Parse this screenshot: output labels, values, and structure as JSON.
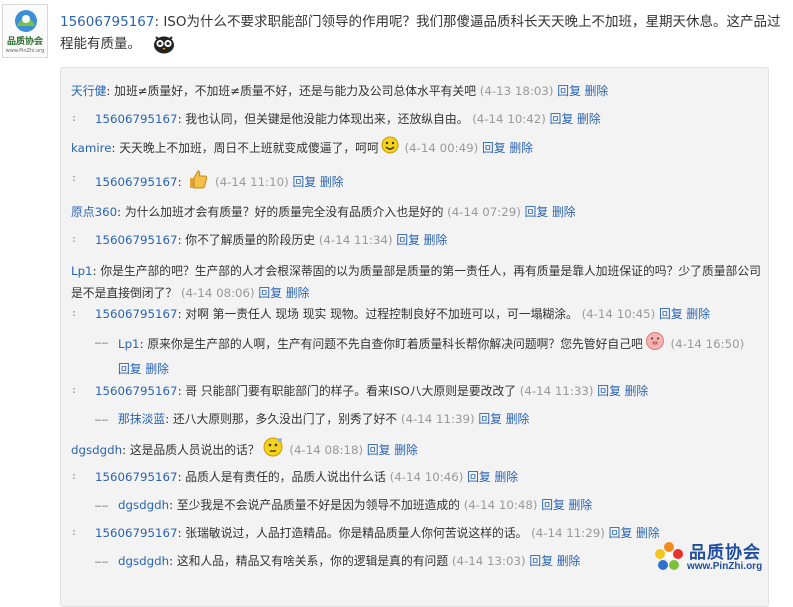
{
  "avatar": {
    "name": "品质协会",
    "url": "www.PinZhi.org"
  },
  "post": {
    "user": "15606795167",
    "text": "ISO为什么不要求职能部门领导的作用呢？我们那傻逼品质科长天天晚上不加班，星期天休息。这产品过程能有质量。",
    "emoji": "owl-emoji"
  },
  "actions": {
    "reply": "回复",
    "delete": "删除"
  },
  "comments": [
    {
      "user": "天行健",
      "text": "加班≠质量好，不加班≠质量不好，还是与能力及公司总体水平有关吧",
      "time": "(4-13 18:03)",
      "level": 0
    },
    {
      "user": "15606795167",
      "text": "我也认同，但关键是他没能力体现出来，还放纵自由。",
      "time": "(4-14 10:42)",
      "level": 1
    },
    {
      "user": "kamire",
      "text": "天天晚上不加班，周日不上班就变成傻逼了，呵呵",
      "emoji": "grin-emoji",
      "time": "(4-14 00:49)",
      "level": 0
    },
    {
      "user": "15606795167",
      "text": "",
      "emoji": "thumbs-up-emoji",
      "time": "(4-14 11:10)",
      "level": 1
    },
    {
      "user": "原点360",
      "text": "为什么加班才会有质量？好的质量完全没有品质介入也是好的",
      "time": "(4-14 07:29)",
      "level": 0
    },
    {
      "user": "15606795167",
      "text": "你不了解质量的阶段历史",
      "time": "(4-14 11:34)",
      "level": 1
    },
    {
      "user": "Lp1",
      "text": "你是生产部的吧？生产部的人才会根深蒂固的以为质量部是质量的第一责任人，再有质量是靠人加班保证的吗？少了质量部公司是不是直接倒闭了？",
      "time": "(4-14 08:06)",
      "level": 0
    },
    {
      "user": "15606795167",
      "text": "对啊 第一责任人 现场 现实 现物。过程控制良好不加班可以，可一塌糊涂。",
      "time": "(4-14 10:45)",
      "level": 1
    },
    {
      "user": "Lp1",
      "text": "原来你是生产部的人啊，生产有问题不先自查你盯着质量科长帮你解决问题啊？您先管好自己吧",
      "emoji": "pig-emoji",
      "time": "(4-14 16:50)",
      "level": 2
    },
    {
      "user": "15606795167",
      "text": "哥 只能部门要有职能部门的样子。看来ISO八大原则是要改改了",
      "time": "(4-14 11:33)",
      "level": 1
    },
    {
      "user": "那抹淡蓝",
      "text": "还八大原则那，多久没出门了，别秀了好不",
      "time": "(4-14 11:39)",
      "level": 2
    },
    {
      "user": "dgsdgdh",
      "text": "这是品质人员说出的话？",
      "emoji": "thinking-emoji",
      "time": "(4-14 08:18)",
      "level": 0
    },
    {
      "user": "15606795167",
      "text": "品质人是有责任的，品质人说出什么话",
      "time": "(4-14 10:46)",
      "level": 1
    },
    {
      "user": "dgsdgdh",
      "text": "至少我是不会说产品质量不好是因为领导不加班造成的",
      "time": "(4-14 10:48)",
      "level": 2
    },
    {
      "user": "15606795167",
      "text": "张瑞敏说过，人品打造精品。你是精品质量人你何苦说这样的话。",
      "time": "(4-14 11:29)",
      "level": 1
    },
    {
      "user": "dgsdgdh",
      "text": "这和人品，精品又有啥关系，你的逻辑是真的有问题",
      "time": "(4-14 13:03)",
      "level": 2
    }
  ],
  "watermark": {
    "name": "品质协会",
    "url": "www.PinZhi.org"
  },
  "colors": {
    "link": "#2a64b2",
    "time": "#999999",
    "panel": "#f3f3f3",
    "brand": "#1f4e9e"
  }
}
